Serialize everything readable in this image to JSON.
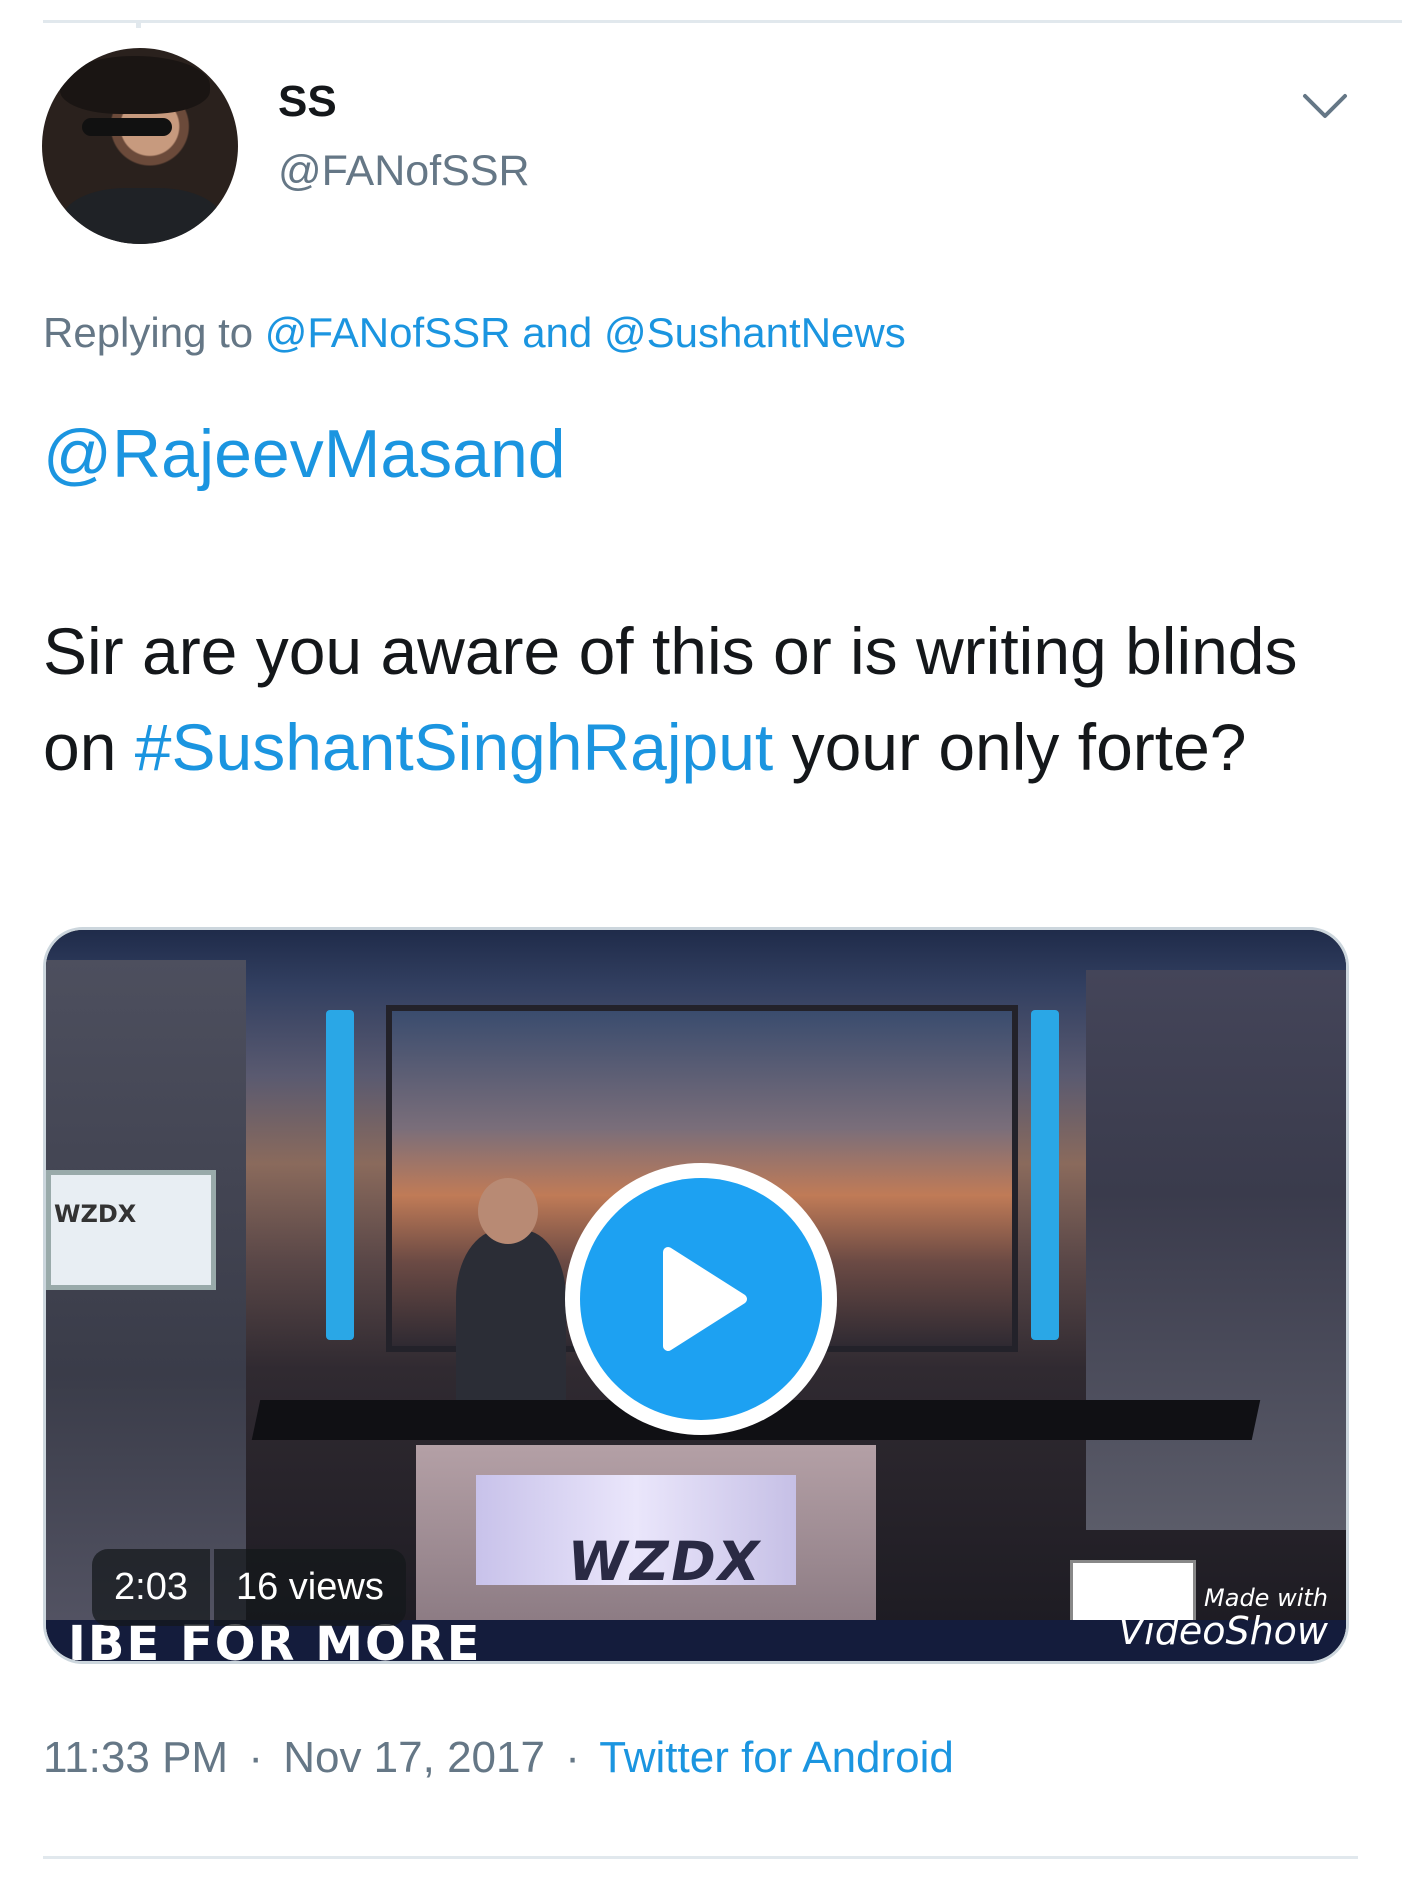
{
  "user": {
    "display_name": "SS",
    "handle": "@FANofSSR"
  },
  "reply": {
    "prefix": "Replying to",
    "mention1": "@FANofSSR",
    "conjunction": "and",
    "mention2": "@SushantNews"
  },
  "tweet": {
    "mention": "@RajeevMasand",
    "text_part1": "Sir are you aware of this or is writing blinds on",
    "hashtag": "#SushantSinghRajput",
    "text_part2": "your only forte?"
  },
  "media": {
    "duration": "2:03",
    "views": "16 views",
    "sign_text": "WZDX",
    "desk_logo": "WZDX",
    "banner_text": "IBE FOR MORE",
    "watermark_small": "Made with",
    "watermark_big": "VideoShow"
  },
  "footer": {
    "time": "11:33 PM",
    "date": "Nov 17, 2017",
    "source": "Twitter for Android",
    "separator": "·"
  },
  "colors": {
    "link": "#1b95e0",
    "secondary_text": "#657786",
    "play_button": "#1da1f2"
  },
  "icons": {
    "menu": "chevron-down-icon",
    "play": "play-icon"
  }
}
